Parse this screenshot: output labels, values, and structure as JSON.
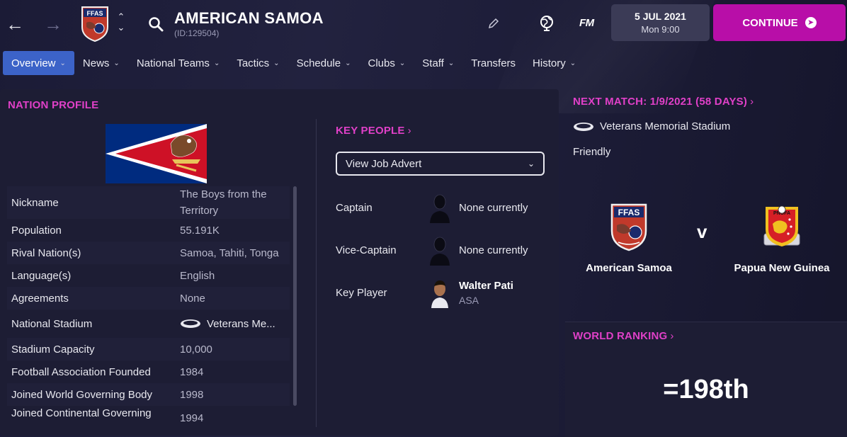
{
  "header": {
    "title": "AMERICAN SAMOA",
    "id_text": "(ID:129504)",
    "crest_text": "FFAS",
    "fm_logo": "FM",
    "date": "5 JUL 2021",
    "time": "Mon 9:00",
    "continue_label": "CONTINUE"
  },
  "tabs": [
    {
      "label": "Overview",
      "active": true,
      "dropdown": true
    },
    {
      "label": "News",
      "dropdown": true
    },
    {
      "label": "National Teams",
      "dropdown": true
    },
    {
      "label": "Tactics",
      "dropdown": true
    },
    {
      "label": "Schedule",
      "dropdown": true
    },
    {
      "label": "Clubs",
      "dropdown": true
    },
    {
      "label": "Staff",
      "dropdown": true
    },
    {
      "label": "Transfers",
      "dropdown": false
    },
    {
      "label": "History",
      "dropdown": true
    }
  ],
  "nation_profile": {
    "title": "NATION PROFILE",
    "rows": [
      {
        "label": "Nickname",
        "value": "The Boys from the Territory"
      },
      {
        "label": "Population",
        "value": "55.191K"
      },
      {
        "label": "Rival Nation(s)",
        "value": "Samoa, Tahiti, Tonga"
      },
      {
        "label": "Language(s)",
        "value": "English"
      },
      {
        "label": "Agreements",
        "value": "None"
      },
      {
        "label": "National Stadium",
        "value": "Veterans Me..."
      },
      {
        "label": "Stadium Capacity",
        "value": "10,000"
      },
      {
        "label": "Football Association Founded",
        "value": "1984"
      },
      {
        "label": "Joined World Governing Body",
        "value": "1998"
      },
      {
        "label": "Joined Continental Governing",
        "value": "1994"
      }
    ]
  },
  "key_people": {
    "title": "KEY PEOPLE",
    "dropdown_label": "View Job Advert",
    "people": [
      {
        "role": "Captain",
        "name": "None currently",
        "nation": ""
      },
      {
        "role": "Vice-Captain",
        "name": "None currently",
        "nation": ""
      },
      {
        "role": "Key Player",
        "name": "Walter Pati",
        "nation": "ASA"
      }
    ]
  },
  "next_match": {
    "title": "NEXT MATCH: 1/9/2021 (58 DAYS)",
    "venue": "Veterans Memorial Stadium",
    "competition": "Friendly",
    "home_team": "American Samoa",
    "home_crest_text": "FFAS",
    "away_team": "Papua New Guinea",
    "away_crest_text": "PNGFA",
    "vs": "v"
  },
  "world_ranking": {
    "title": "WORLD RANKING",
    "value": "=198th"
  },
  "colors": {
    "accent_magenta": "#e040c8",
    "continue_bg": "#b80ea8",
    "tab_active_bg": "#3c63c8"
  }
}
